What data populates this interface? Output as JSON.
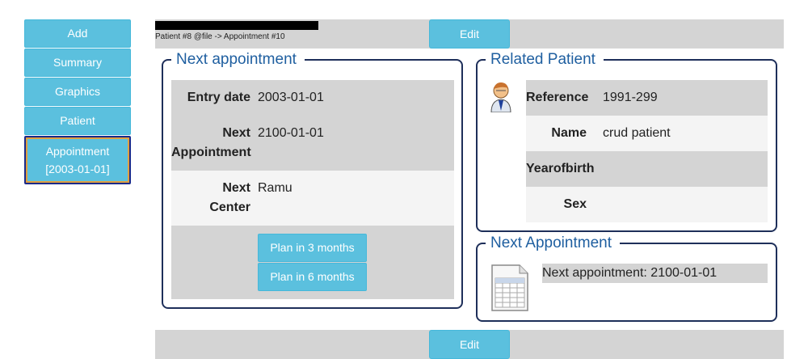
{
  "menu": {
    "items": [
      {
        "label": "Add"
      },
      {
        "label": "Summary"
      },
      {
        "label": "Graphics"
      },
      {
        "label": "Patient"
      }
    ],
    "active": {
      "line1": "Appointment",
      "line2": "[2003-01-01]"
    }
  },
  "top_bar": {
    "breadcrumb": "Patient #8 @file -> Appointment #10",
    "edit_label": "Edit"
  },
  "bottom_bar": {
    "edit_label": "Edit"
  },
  "next_appointment": {
    "legend": "Next appointment",
    "rows": [
      {
        "label": "Entry date",
        "value": "2003-01-01"
      },
      {
        "label_line1": "Next",
        "label_line2": "Appointment",
        "value": "2100-01-01"
      },
      {
        "label_line1": "Next",
        "label_line2": "Center",
        "value": "Ramu"
      }
    ],
    "plan3_label": "Plan in 3 months",
    "plan6_label": "Plan in 6 months"
  },
  "related_patient": {
    "legend": "Related Patient",
    "icon": "patient-icon",
    "rows": [
      {
        "label": "Reference",
        "value": "1991-299"
      },
      {
        "label": "Name",
        "value": "crud patient"
      },
      {
        "label": "Yearofbirth",
        "value": ""
      },
      {
        "label": "Sex",
        "value": ""
      }
    ]
  },
  "next_appointment_summary": {
    "legend": "Next Appointment",
    "icon": "document-icon",
    "text": "Next appointment: 2100-01-01"
  },
  "colors": {
    "button": "#5bc0de",
    "legend_text": "#1f5fa0",
    "fieldset_border": "#1e2f5a",
    "bar_grey": "#d4d4d4"
  }
}
